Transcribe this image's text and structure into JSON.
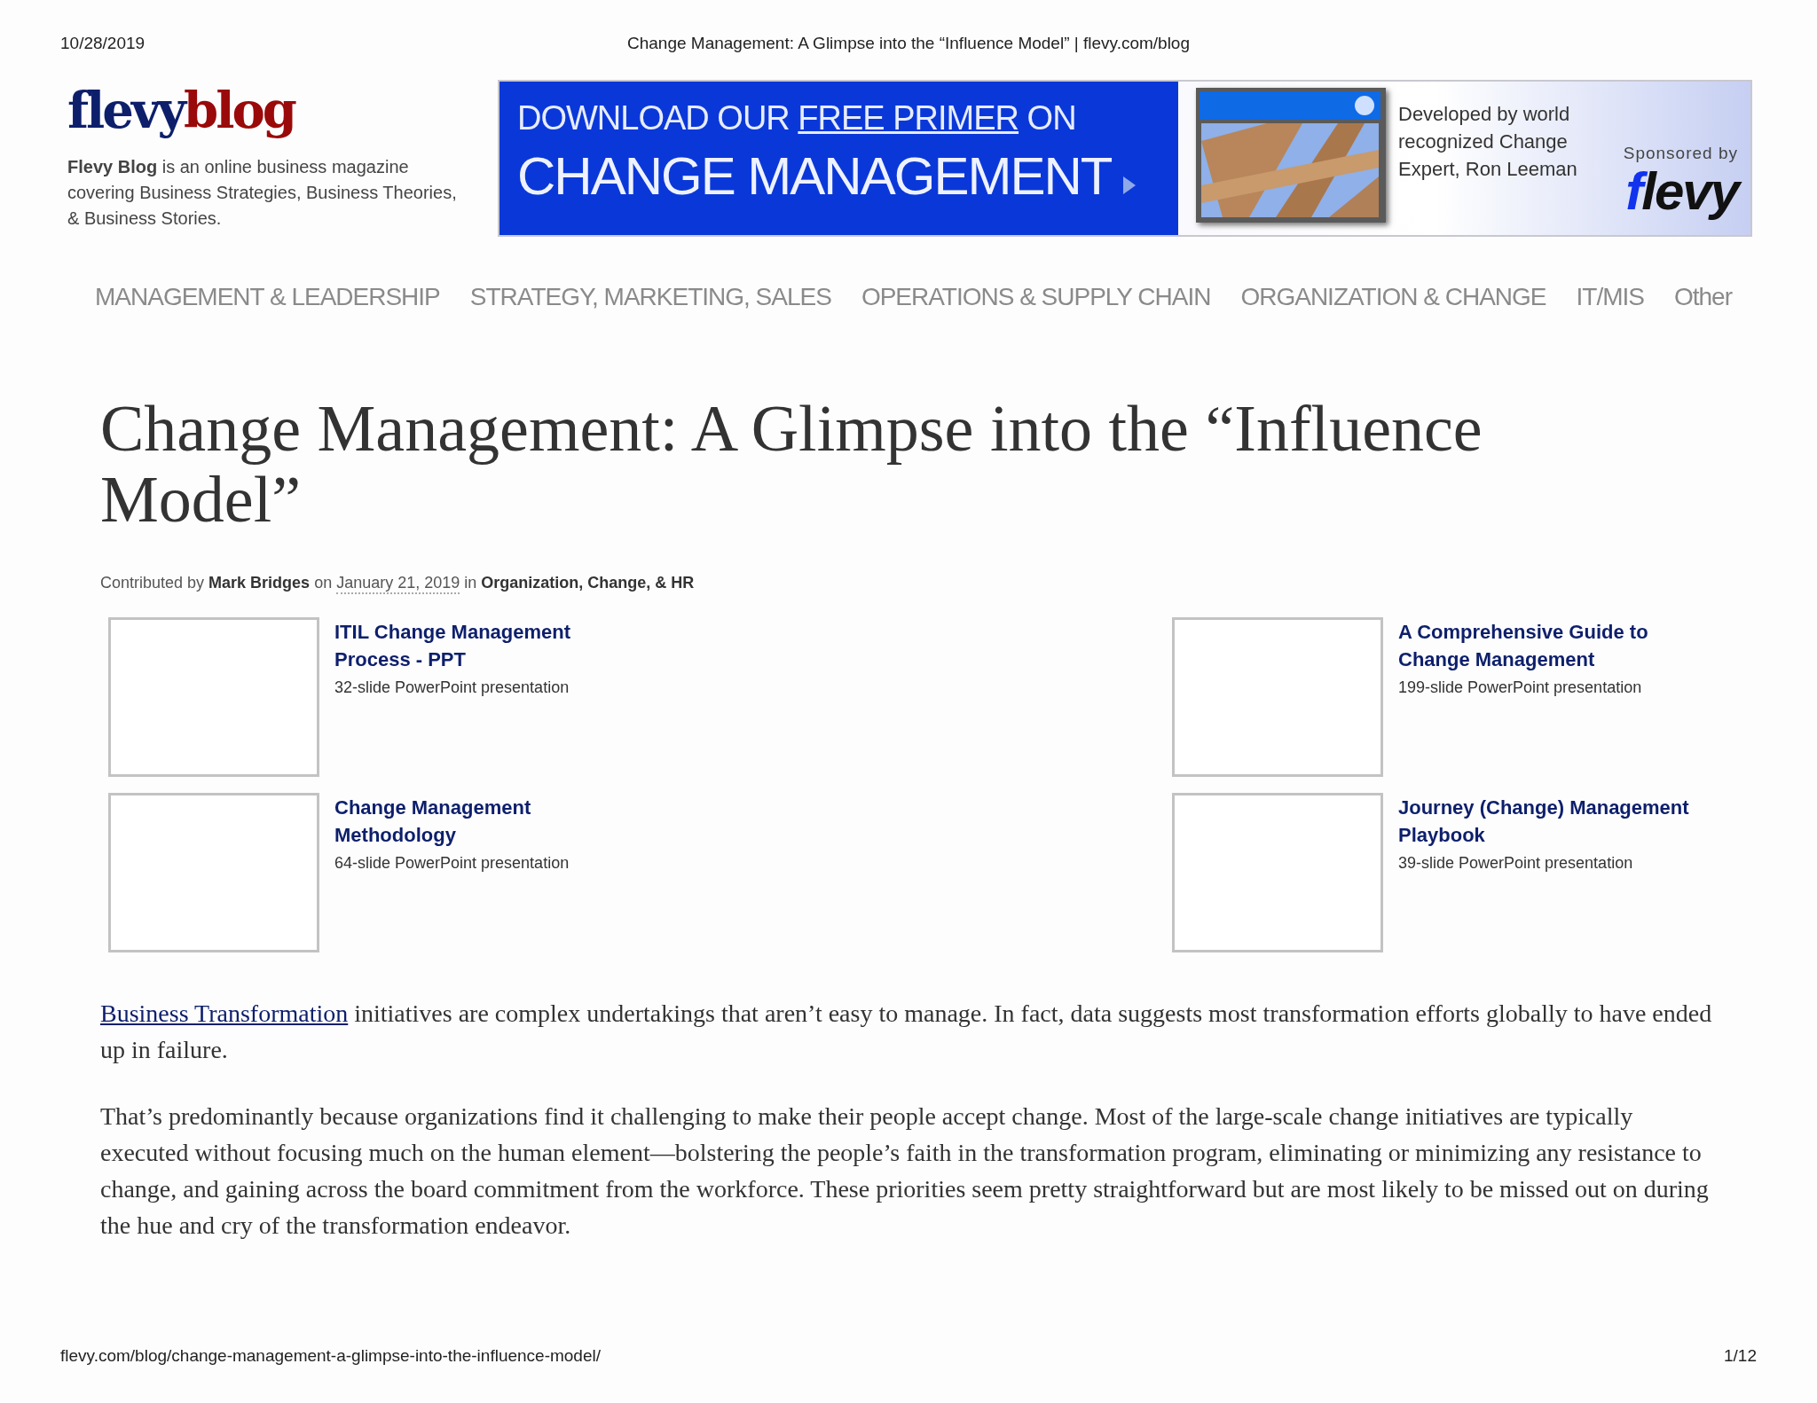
{
  "print_header": {
    "date": "10/28/2019",
    "title": "Change Management: A Glimpse into the “Influence Model” | flevy.com/blog"
  },
  "logo": {
    "first": "flevy",
    "second": "blog"
  },
  "tagline": {
    "bold": "Flevy Blog",
    "text": " is an online business magazine covering Business Strategies, Business Theories, & Business Stories."
  },
  "banner": {
    "line1_before": "DOWNLOAD OUR ",
    "line1_link": "FREE PRIMER",
    "line1_after": " ON",
    "line2": "CHANGE MANAGEMENT",
    "blurb": "Developed by world recognized Change Expert, Ron Leeman",
    "sponsored": "Sponsored by",
    "brand": "flevy"
  },
  "nav": [
    "MANAGEMENT & LEADERSHIP",
    "STRATEGY, MARKETING, SALES",
    "OPERATIONS & SUPPLY CHAIN",
    "ORGANIZATION & CHANGE",
    "IT/MIS",
    "Other"
  ],
  "article": {
    "title": "Change Management: A Glimpse into the “Influence Model”",
    "meta": {
      "prefix": "Contributed by",
      "author": "Mark Bridges",
      "on": "on",
      "date": "January 21, 2019",
      "in": "in",
      "category": "Organization, Change, & HR"
    },
    "products": [
      {
        "title": "ITIL Change Management Process - PPT",
        "subtitle": "32-slide PowerPoint presentation"
      },
      {
        "title": "A Comprehensive Guide to Change Management",
        "subtitle": "199-slide PowerPoint presentation"
      },
      {
        "title": "Change Management Methodology",
        "subtitle": "64-slide PowerPoint presentation"
      },
      {
        "title": "Journey (Change) Management Playbook",
        "subtitle": "39-slide PowerPoint presentation"
      }
    ],
    "paragraphs": [
      {
        "link": "Business Transformation",
        "text": " initiatives are complex undertakings that aren’t easy to manage.  In fact, data suggests most transformation efforts globally to have ended up in failure."
      },
      {
        "text": "That’s predominantly because organizations find it challenging to make their people accept change.  Most of the large-scale change initiatives are typically executed without focusing much on the human element—bolstering the people’s faith in the transformation program, eliminating or minimizing any resistance to change, and gaining across the board commitment from the workforce.  These priorities seem pretty straightforward but are most likely to be missed out on during the hue and cry of the transformation endeavor."
      }
    ]
  },
  "print_footer": {
    "url": "flevy.com/blog/change-management-a-glimpse-into-the-influence-model/",
    "page": "1/12"
  }
}
